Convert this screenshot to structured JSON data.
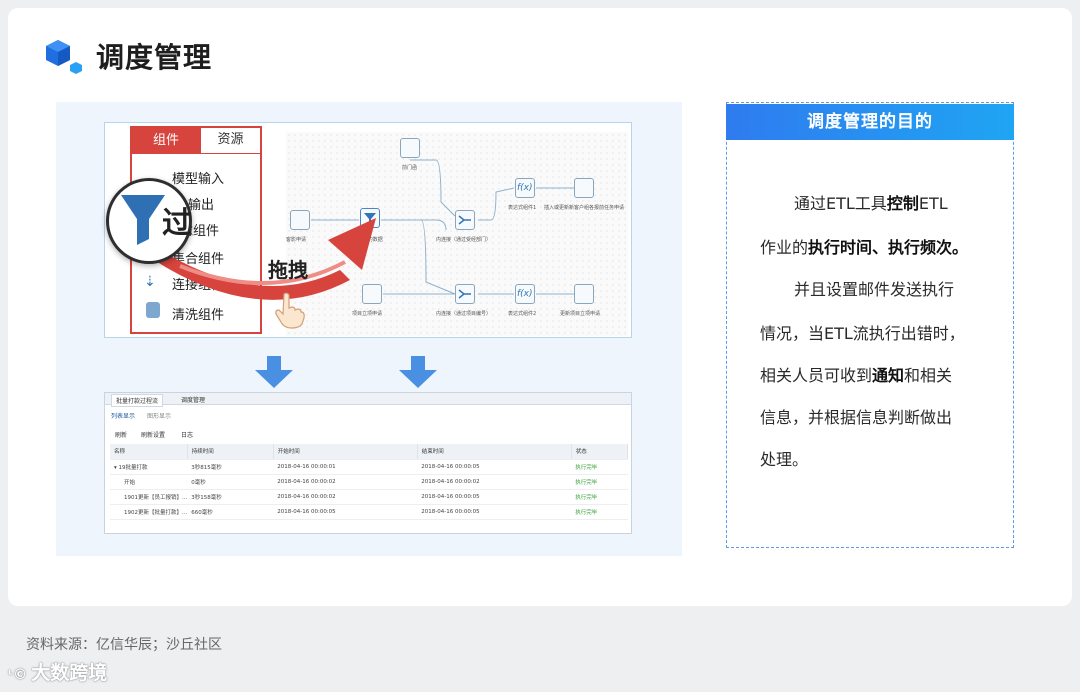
{
  "header": {
    "title": "调度管理"
  },
  "components_panel": {
    "tabs": [
      "组件",
      "资源"
    ],
    "items": [
      "模型输入",
      "输出",
      "滤组件",
      "集合组件",
      "连接组件",
      "清洗组件"
    ]
  },
  "overlay": {
    "magnify_char": "过",
    "drag_label": "拖拽"
  },
  "flow_nodes": {
    "n1": "前门函",
    "n2": "客影申请",
    "n3": "过滤...后的数据",
    "n4": "内连接（通过受经部门）",
    "n5": "表达式组件1",
    "n6": "插入或更新新客户组各报前任务申请",
    "n7": "项目立项申请",
    "n8": "内连接（通过项目编号）",
    "n9": "表达式组件2",
    "n10": "更新项目立项申请"
  },
  "table_window": {
    "tabs": [
      "批量打款过程流",
      "调度管理"
    ],
    "subtabs": [
      "列表显示",
      "图形显示"
    ],
    "toolbar": [
      "刷新",
      "刷新设置",
      "日志"
    ],
    "columns": [
      "名称",
      "持续时间",
      "开始时间",
      "结束时间",
      "状态"
    ],
    "rows": [
      [
        "▾ 19批量打款",
        "3秒815毫秒",
        "2018-04-16 00:00:01",
        "2018-04-16 00:00:05",
        "执行完毕"
      ],
      [
        "开始",
        "0毫秒",
        "2018-04-16 00:00:02",
        "2018-04-16 00:00:02",
        "执行完毕"
      ],
      [
        "1901更新【员工报销】...",
        "3秒158毫秒",
        "2018-04-16 00:00:02",
        "2018-04-16 00:00:05",
        "执行完毕"
      ],
      [
        "1902更新【批量打款】...",
        "660毫秒",
        "2018-04-16 00:00:05",
        "2018-04-16 00:00:05",
        "执行完毕"
      ]
    ]
  },
  "purpose": {
    "heading": "调度管理的目的",
    "p1": {
      "a": "通过ETL工具",
      "b": "控制",
      "c": "ETL",
      "d": "作业的",
      "e": "执行时间、执行频次。"
    },
    "p2": {
      "a": "并且设置邮件发送执行",
      "b": "情况，当ETL流执行出错时，",
      "c": "相关人员可收到",
      "d": "通知",
      "e": "和相关",
      "f": "信息，并根据信息判断做出",
      "g": "处理。"
    }
  },
  "footer": {
    "source": "资料来源：亿信华辰；沙丘社区",
    "watermark": "大数跨境"
  },
  "colors": {
    "accent": "#2f7bef",
    "red": "#d6443d",
    "arrow_blue": "#4a90e2"
  }
}
